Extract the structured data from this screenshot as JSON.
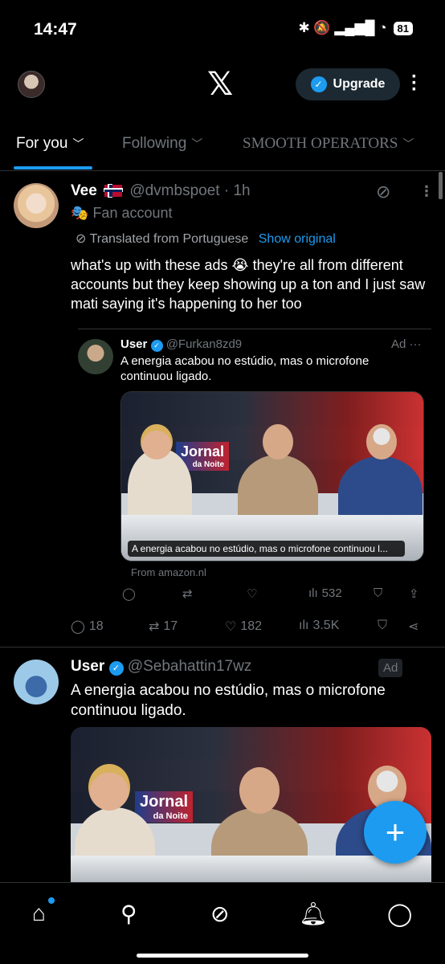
{
  "status_bar": {
    "time": "14:47",
    "icons": "✱ 🔕 ▂▄▆█ ◔",
    "battery": "81"
  },
  "header": {
    "logo": "𝕏",
    "upgrade_label": "Upgrade",
    "more_icon": "more-vertical-icon"
  },
  "tabs": [
    {
      "label": "For you",
      "active": true
    },
    {
      "label": "Following",
      "active": false
    },
    {
      "label": "SMOOTH OPERATORS",
      "active": false
    }
  ],
  "post1": {
    "name": "Vee",
    "handle": "@dvmbspoet",
    "time": "· 1h",
    "fan_label": "Fan account",
    "translated_label": "Translated from Portuguese",
    "show_original": "Show original",
    "text": "what's up with these ads 😭 they're all from different accounts but they keep showing up a ton and I just saw mati saying it's happening to her too",
    "embed": {
      "name": "User",
      "handle": "@Furkan8zd9",
      "ad_label": "Ad",
      "more": "···",
      "text": "A energia acabou no estúdio, mas o microfone continuou ligado.",
      "caption": "A energia acabou no estúdio, mas o microfone continuou l...",
      "source": "From amazon.nl",
      "views": "532",
      "studio_logo": "Jornal",
      "studio_logo_sub": "da Noite"
    },
    "stats": {
      "replies": "18",
      "reposts": "17",
      "likes": "182",
      "views": "3.5K"
    }
  },
  "post2": {
    "name": "User",
    "handle": "@Sebahattin17wz",
    "ad_label": "Ad",
    "text": "A energia acabou no estúdio, mas o microfone continuou ligado.",
    "studio_logo": "Jornal",
    "studio_logo_sub": "da Noite"
  },
  "fab": {
    "label": "+"
  },
  "colors": {
    "accent": "#1d9bf0",
    "background": "#000000",
    "muted": "#71767b"
  }
}
